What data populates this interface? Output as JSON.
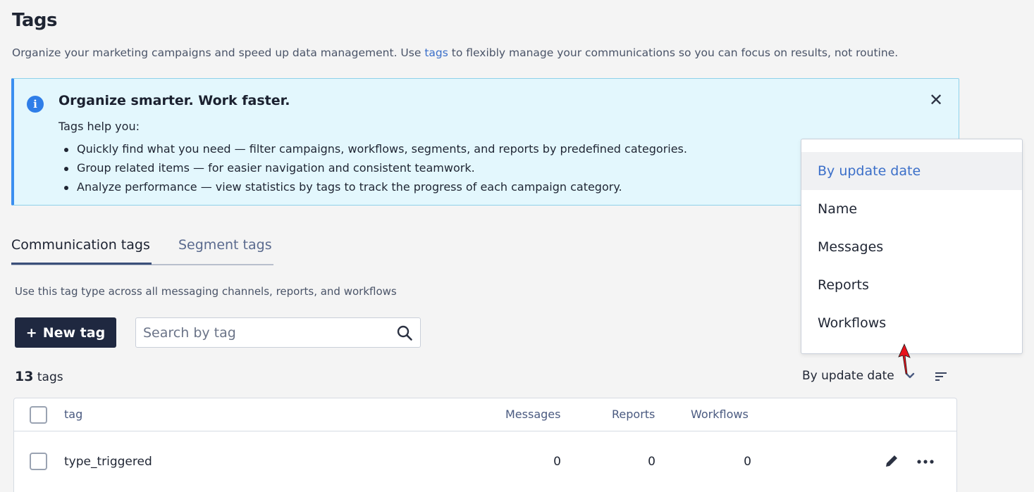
{
  "page": {
    "title": "Tags",
    "subtitle_before": "Organize your marketing campaigns and speed up data management. Use ",
    "subtitle_link": "tags",
    "subtitle_after": " to flexibly manage your communications so you can focus on results, not routine."
  },
  "banner": {
    "title": "Organize smarter. Work faster.",
    "intro": "Tags help you:",
    "items": [
      "Quickly find what you need — filter campaigns, workflows, segments, and reports by predefined categories.",
      "Group related items — for easier navigation and consistent teamwork.",
      "Analyze performance — view statistics by tags to track the progress of each campaign category."
    ],
    "close_symbol": "✕",
    "info_symbol": "i"
  },
  "tabs": [
    {
      "label": "Communication tags",
      "active": true
    },
    {
      "label": "Segment tags",
      "active": false
    }
  ],
  "tab_description": "Use this tag type across all messaging channels, reports, and workflows",
  "toolbar": {
    "new_tag_plus": "+",
    "new_tag_label": "New tag",
    "search_placeholder": "Search by tag"
  },
  "summary": {
    "count": "13",
    "count_label": "tags"
  },
  "sort": {
    "current": "By update date",
    "options": [
      "By update date",
      "Name",
      "Messages",
      "Reports",
      "Workflows"
    ]
  },
  "table": {
    "columns": {
      "tag": "tag",
      "messages": "Messages",
      "reports": "Reports",
      "workflows": "Workflows"
    },
    "rows": [
      {
        "tag": "type_triggered",
        "messages": "0",
        "reports": "0",
        "workflows": "0"
      }
    ]
  },
  "colors": {
    "accent": "#3b6fc9",
    "primary_button": "#1f2840",
    "banner_bg": "#e3f7fd",
    "banner_border": "#3a8ff0",
    "cursor": "#e8131c"
  }
}
